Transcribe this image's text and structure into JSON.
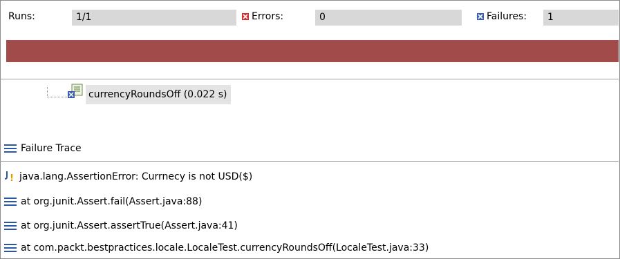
{
  "stats": {
    "runs_label": "Runs:",
    "runs_value": "1/1",
    "errors_label": "Errors:",
    "errors_value": "0",
    "failures_label": "Failures:",
    "failures_value": "1"
  },
  "progress": {
    "state": "failed",
    "color": "#a24b4b",
    "fraction": 1.0
  },
  "tree": {
    "item_label": "currencyRoundsOff (0.022 s)"
  },
  "trace": {
    "header": "Failure Trace",
    "lines": [
      "java.lang.AssertionError: Currnecy is not USD($)",
      "at org.junit.Assert.fail(Assert.java:88)",
      "at org.junit.Assert.assertTrue(Assert.java:41)",
      "at com.packt.bestpractices.locale.LocaleTest.currencyRoundsOff(LocaleTest.java:33)"
    ]
  },
  "icons": {
    "errors": "error-icon",
    "failures": "failure-icon",
    "test": "test-failed-icon",
    "trace": "stack-icon",
    "assert": "junit-assertion-icon"
  },
  "colors": {
    "failure_bar": "#a24b4b",
    "accent": "#2a56a6",
    "error": "#d03030"
  }
}
